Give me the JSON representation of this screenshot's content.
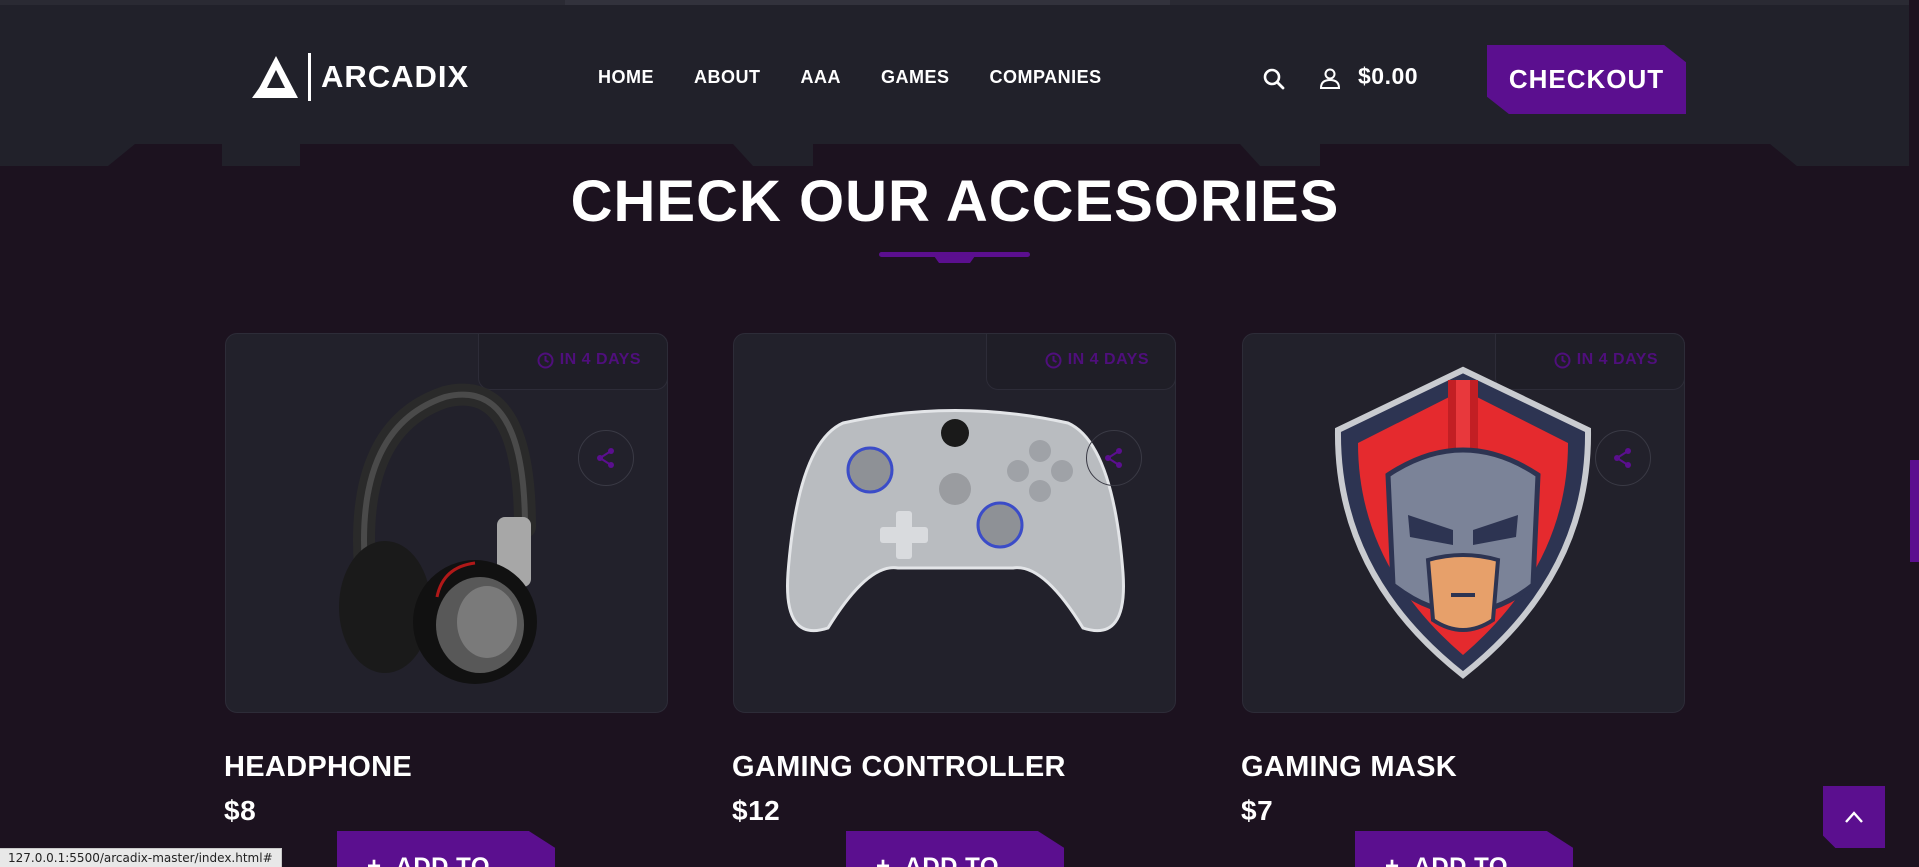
{
  "brand": {
    "logo_text": "ARCADIX"
  },
  "nav": {
    "items": [
      "HOME",
      "ABOUT",
      "AAA",
      "GAMES",
      "COMPANIES"
    ]
  },
  "header": {
    "cart_total": "$0.00",
    "checkout_label": "CHECKOUT"
  },
  "section": {
    "title": "CHECK OUR ACCESORIES"
  },
  "products": [
    {
      "name": "HEADPHONE",
      "price": "$8",
      "badge": "IN 4 DAYS",
      "button": "ADD TO CART"
    },
    {
      "name": "GAMING CONTROLLER",
      "price": "$12",
      "badge": "IN 4 DAYS",
      "button": "ADD TO CART"
    },
    {
      "name": "GAMING MASK",
      "price": "$7",
      "badge": "IN 4 DAYS",
      "button": "ADD TO CART"
    }
  ],
  "status_bar": {
    "url": "127.0.0.1:5500/arcadix-master/index.html#"
  },
  "colors": {
    "accent": "#5b0f8f",
    "background": "#1c121f",
    "header": "#21212a",
    "card": "#22212b"
  }
}
